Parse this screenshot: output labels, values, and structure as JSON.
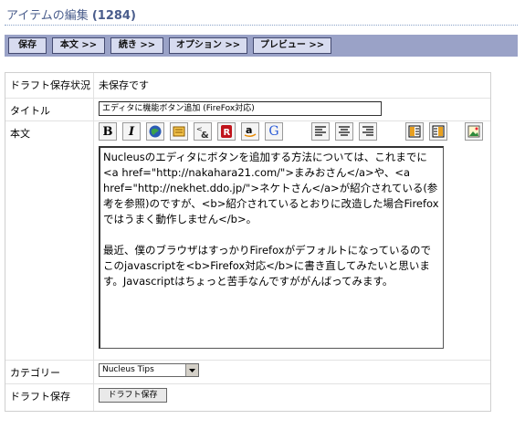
{
  "header": {
    "title": "アイテムの編集",
    "count": "(1284)"
  },
  "tabs": [
    {
      "label": "保存"
    },
    {
      "label": "本文 >>"
    },
    {
      "label": "続き >>"
    },
    {
      "label": "オプション >>"
    },
    {
      "label": "プレビュー >>"
    }
  ],
  "form": {
    "draft_status": {
      "label": "ドラフト保存状況",
      "value": "未保存です"
    },
    "title": {
      "label": "タイトル",
      "value": "エディタに機能ボタン追加 (FireFox対応)"
    },
    "body": {
      "label": "本文",
      "text": "Nucleusのエディタにボタンを追加する方法については、これまでに<a href=\"http://nakahara21.com/\">まみおさん</a>や、<a href=\"http://nekhet.ddo.jp/\">ネケトさん</a>が紹介されている(参考を参照)のですが、<b>紹介されているとおりに改造した場合Firefoxではうまく動作しません</b>。\n\n最近、僕のブラウザはすっかりFirefoxがデフォルトになっているのでこのjavascriptを<b>Firefox対応</b>に書き直してみたいと思います。Javascriptはちょっと苦手なんですががんばってみます。"
    },
    "category": {
      "label": "カテゴリー",
      "selected": "Nucleus Tips"
    },
    "draft_save": {
      "label": "ドラフト保存",
      "button": "ドラフト保存"
    }
  },
  "toolbar": [
    {
      "icon": "bold-icon",
      "glyph": "B"
    },
    {
      "icon": "italic-icon",
      "glyph": "I"
    },
    {
      "icon": "link-icon"
    },
    {
      "icon": "note-icon"
    },
    {
      "icon": "ampersand-link-icon"
    },
    {
      "icon": "r-icon",
      "glyph": "R"
    },
    {
      "icon": "amazon-icon",
      "glyph": "a"
    },
    {
      "icon": "google-icon",
      "glyph": "G"
    },
    {
      "icon": "align-left-icon"
    },
    {
      "icon": "align-center-icon"
    },
    {
      "icon": "align-right-icon"
    },
    {
      "icon": "column-left-icon"
    },
    {
      "icon": "column-right-icon"
    },
    {
      "icon": "image-icon"
    }
  ]
}
